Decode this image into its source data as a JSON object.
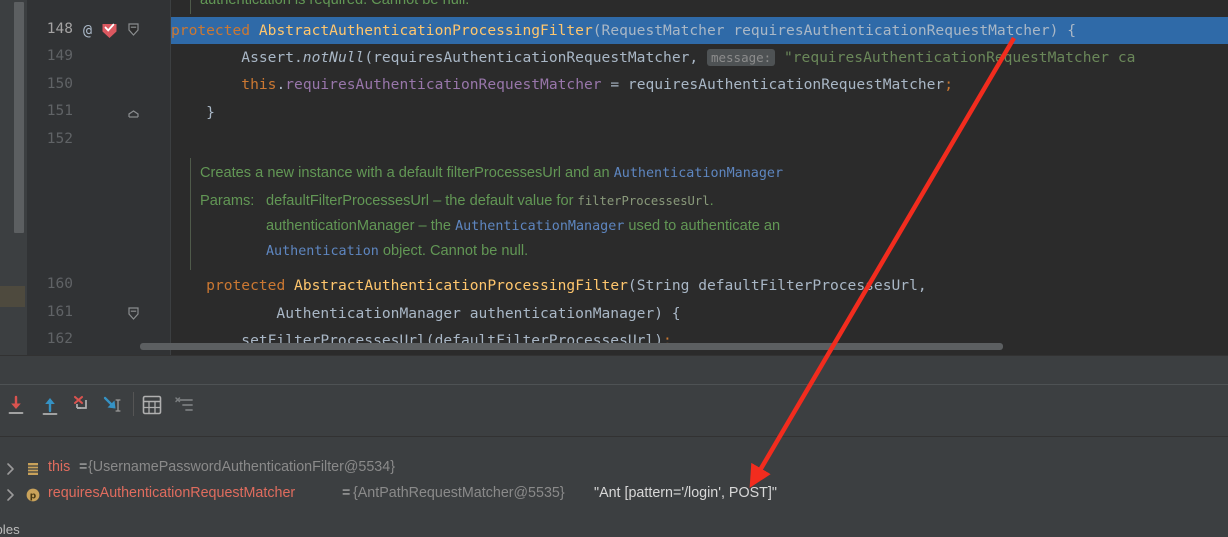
{
  "editor": {
    "partial_top_line": "authentication is required. Cannot be null.",
    "lines": [
      {
        "number": "148",
        "gutter": {
          "annotation": "@",
          "breakpoint": "verified-breakpoint-icon",
          "fold": "fold-collapse-icon"
        },
        "highlighted": true,
        "tokens": [
          {
            "t": "protected ",
            "c": "kw"
          },
          {
            "t": "AbstractAuthenticationProcessingFilter",
            "c": "cls"
          },
          {
            "t": "(RequestMatcher requiresAuthenticationRequestMatcher) {",
            "c": "id"
          }
        ]
      },
      {
        "number": "149",
        "tokens": [
          {
            "t": "        Assert.",
            "c": "id"
          },
          {
            "t": "notNull",
            "c": "ital"
          },
          {
            "t": "(requiresAuthenticationRequestMatcher, ",
            "c": "id"
          },
          {
            "t": "message:",
            "c": "hint"
          },
          {
            "t": " \"requiresAuthenticationRequestMatcher ca",
            "c": "str"
          }
        ]
      },
      {
        "number": "150",
        "tokens": [
          {
            "t": "        ",
            "c": "id"
          },
          {
            "t": "this",
            "c": "kw"
          },
          {
            "t": ".",
            "c": "id"
          },
          {
            "t": "requiresAuthenticationRequestMatcher",
            "c": "fld"
          },
          {
            "t": " = requiresAuthenticationRequestMatcher",
            "c": "id"
          },
          {
            "t": ";",
            "c": "semi"
          }
        ]
      },
      {
        "number": "151",
        "gutter": {
          "fold": "fold-end-icon"
        },
        "tokens": [
          {
            "t": "    }",
            "c": "id"
          }
        ]
      },
      {
        "number": "152",
        "tokens": []
      },
      {
        "number": "160",
        "tokens": [
          {
            "t": "    ",
            "c": "id"
          },
          {
            "t": "protected ",
            "c": "kw"
          },
          {
            "t": "AbstractAuthenticationProcessingFilter",
            "c": "cls"
          },
          {
            "t": "(String defaultFilterProcessesUrl,",
            "c": "id"
          }
        ]
      },
      {
        "number": "161",
        "gutter": {
          "fold": "fold-collapse-icon"
        },
        "tokens": [
          {
            "t": "            AuthenticationManager authenticationManager) {",
            "c": "id"
          }
        ]
      },
      {
        "number": "162",
        "tokens": [
          {
            "t": "        setFilterProcessesUrl(defaultFilterProcessesUrl)",
            "c": "mcall"
          },
          {
            "t": ";",
            "c": "semi"
          }
        ]
      }
    ],
    "javadoc": {
      "summary_text": "Creates a new instance with a default filterProcessesUrl and an ",
      "summary_link": "AuthenticationManager",
      "params_label": "Params:",
      "param1_name": "defaultFilterProcessesUrl",
      "param1_dash": " – the default value for ",
      "param1_code": "filterProcessesUrl",
      "param1_tail": ".",
      "param2_name": "authenticationManager",
      "param2_dash": " – the ",
      "param2_link": "AuthenticationManager",
      "param2_tail": " used to authenticate an",
      "param3_link": "Authentication",
      "param3_tail": " object. Cannot be null."
    }
  },
  "debugger": {
    "toolbar": [
      {
        "name": "step-over-icon",
        "title": "Step Over"
      },
      {
        "name": "step-out-icon",
        "title": "Step Out"
      },
      {
        "name": "force-step-into-icon",
        "title": "Force Step Into"
      },
      {
        "name": "run-to-cursor-icon",
        "title": "Run to Cursor"
      },
      {
        "name": "evaluate-expression-icon",
        "title": "Evaluate Expression"
      },
      {
        "name": "sort-values-icon",
        "title": "Sort Values"
      }
    ],
    "tab_label": "ables",
    "variables": [
      {
        "icon": "object-field-icon",
        "name": "this",
        "equals": " = ",
        "value": "{UsernamePasswordAuthenticationFilter@5534}",
        "string_value": "",
        "expand": "chevron-right-icon"
      },
      {
        "icon": "parameter-icon",
        "icon_letter": "p",
        "name": "requiresAuthenticationRequestMatcher",
        "equals": " = ",
        "value": "{AntPathRequestMatcher@5535}",
        "string_value": "\"Ant [pattern='/login', POST]\"",
        "expand": "chevron-right-icon"
      }
    ]
  },
  "annotation": {
    "arrow_color": "#f22c1e",
    "arrow_name": "red-annotation-arrow"
  }
}
